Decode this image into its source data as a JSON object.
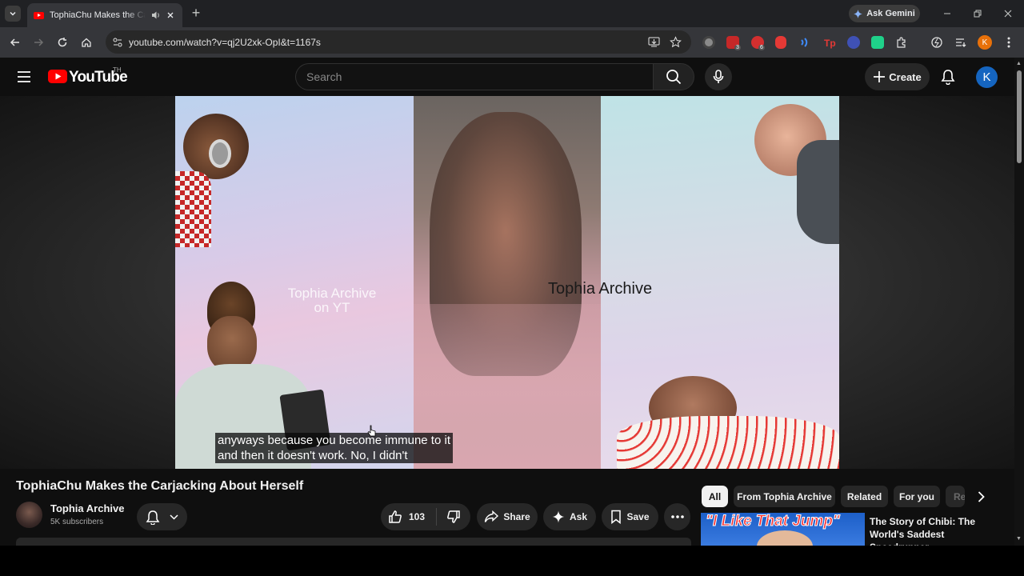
{
  "browser": {
    "tab_title": "TophiaChu Makes the Carjacking About Herself",
    "new_tab_symbol": "+",
    "ask_gemini_label": "Ask Gemini",
    "url": "youtube.com/watch?v=qj2U2xk-OpI&t=1167s",
    "extension_badges": [
      "3",
      "6"
    ],
    "profile_initial": "K"
  },
  "youtube": {
    "logo_text": "YouTube",
    "region": "TH",
    "search_placeholder": "Search",
    "create_label": "Create",
    "avatar_initial": "K",
    "accent_color": "#ff0000"
  },
  "video": {
    "watermark_mid_line1": "Tophia Archive",
    "watermark_mid_line2": "on YT",
    "watermark_right": "Tophia Archive",
    "caption_line1": "anyways because you become immune to it",
    "caption_line2": "and then it doesn't work. No, I didn't"
  },
  "details": {
    "title": "TophiaChu Makes the Carjacking About Herself",
    "channel_name": "Tophia Archive",
    "subscribers": "5K subscribers",
    "like_count": "103",
    "share_label": "Share",
    "ask_label": "Ask",
    "save_label": "Save"
  },
  "sidebar": {
    "chips": [
      "All",
      "From Tophia Archive",
      "Related",
      "For you",
      "Re"
    ],
    "active_chip": "All",
    "recommendation": {
      "thumb_text": "\"I Like That Jump\"",
      "title": "The Story of Chibi: The World's Saddest Speedrunner"
    }
  }
}
